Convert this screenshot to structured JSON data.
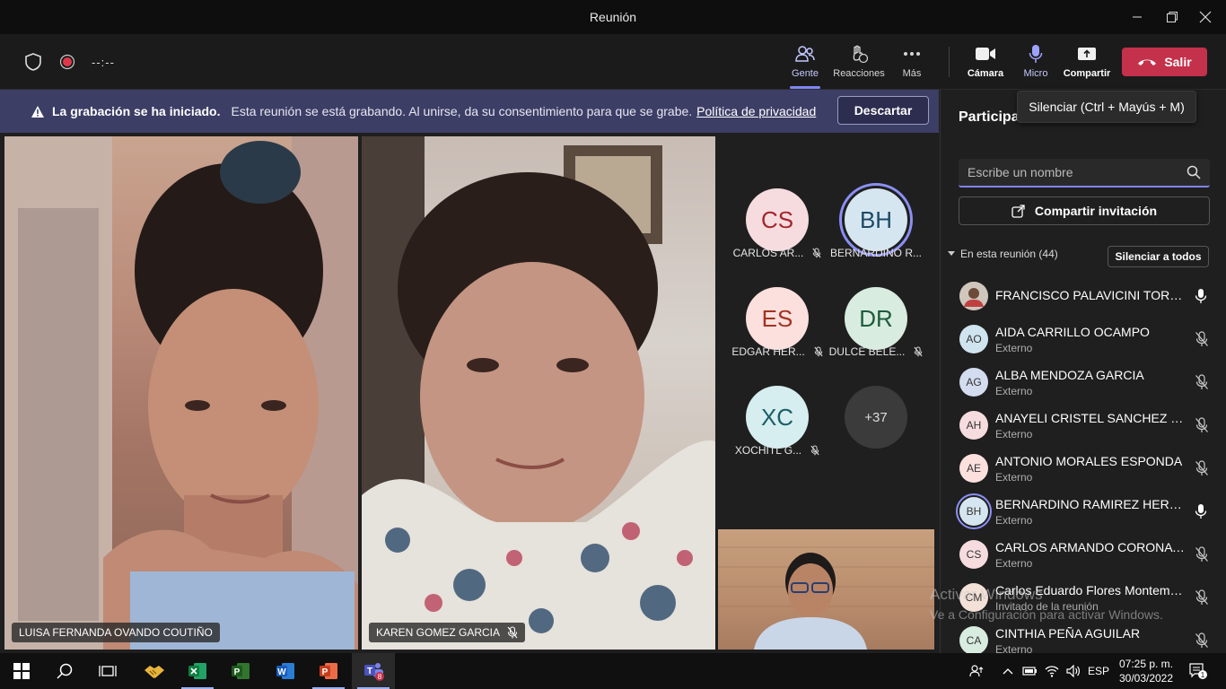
{
  "window": {
    "title": "Reunión"
  },
  "toolbar": {
    "timer": "--:--",
    "people": "Gente",
    "reactions": "Reacciones",
    "more": "Más",
    "camera": "Cámara",
    "mic": "Micro",
    "share": "Compartir",
    "leave": "Salir"
  },
  "tooltip": "Silenciar (Ctrl + Mayús + M)",
  "banner": {
    "title": "La grabación se ha iniciado.",
    "message": "Esta reunión se está grabando. Al unirse, da su consentimiento para que se grabe.",
    "link": "Política de privacidad",
    "dismiss": "Descartar"
  },
  "videos": [
    {
      "name": "LUISA FERNANDA OVANDO COUTIÑO"
    },
    {
      "name": "KAREN GOMEZ GARCIA"
    }
  ],
  "tiles": [
    {
      "initials": "CS",
      "label": "CARLOS AR...",
      "bg": "#f6dcdf",
      "fg": "#a4262c"
    },
    {
      "initials": "BH",
      "label": "BERNARDINO R...",
      "bg": "#d6e6f0",
      "fg": "#1b4968"
    },
    {
      "initials": "ES",
      "label": "EDGAR HER...",
      "bg": "#fbe0dd",
      "fg": "#a33321"
    },
    {
      "initials": "DR",
      "label": "DULCE BELE...",
      "bg": "#d8ece0",
      "fg": "#1e5c3a"
    },
    {
      "initials": "XC",
      "label": "XOCHITL G...",
      "bg": "#d6eef0",
      "fg": "#1b5e66"
    }
  ],
  "more_count": "+37",
  "panel": {
    "title": "Participantes",
    "search_placeholder": "Escribe un nombre",
    "invite": "Compartir invitación",
    "section": "En esta reunión (44)",
    "mute_all": "Silenciar a todos",
    "participants": [
      {
        "initials": "",
        "name": "FRANCISCO PALAVICINI TORRES",
        "sub": "",
        "mic": "on",
        "bg": "#8a7a6a"
      },
      {
        "initials": "AO",
        "name": "AIDA CARRILLO OCAMPO",
        "sub": "Externo",
        "mic": "off",
        "bg": "#cfe4ee"
      },
      {
        "initials": "AG",
        "name": "ALBA MENDOZA GARCIA",
        "sub": "Externo",
        "mic": "off",
        "bg": "#d4dcef"
      },
      {
        "initials": "AH",
        "name": "ANAYELI CRISTEL SANCHEZ HER...",
        "sub": "Externo",
        "mic": "off",
        "bg": "#f6dcdf"
      },
      {
        "initials": "AE",
        "name": "ANTONIO MORALES ESPONDA",
        "sub": "Externo",
        "mic": "off",
        "bg": "#fbe0dd"
      },
      {
        "initials": "BH",
        "name": "BERNARDINO RAMIREZ HERN...",
        "sub": "Externo",
        "mic": "on",
        "bg": "#d6e6f0"
      },
      {
        "initials": "CS",
        "name": "CARLOS ARMANDO CORONA S...",
        "sub": "Externo",
        "mic": "off",
        "bg": "#f6dcdf"
      },
      {
        "initials": "CM",
        "name": "Carlos Eduardo Flores Montema...",
        "sub": "Invitado de la reunión",
        "mic": "off",
        "bg": "#f3e1d7"
      },
      {
        "initials": "CA",
        "name": "CINTHIA PEÑA AGUILAR",
        "sub": "Externo",
        "mic": "off",
        "bg": "#d8ece0"
      }
    ]
  },
  "watermark": {
    "line1": "Activar Windows",
    "line2": "Ve a Configuración para activar Windows."
  },
  "taskbar": {
    "language": "ESP",
    "time": "07:25 p. m.",
    "date": "30/03/2022",
    "teams_badge": "8",
    "notif_badge": "1"
  }
}
